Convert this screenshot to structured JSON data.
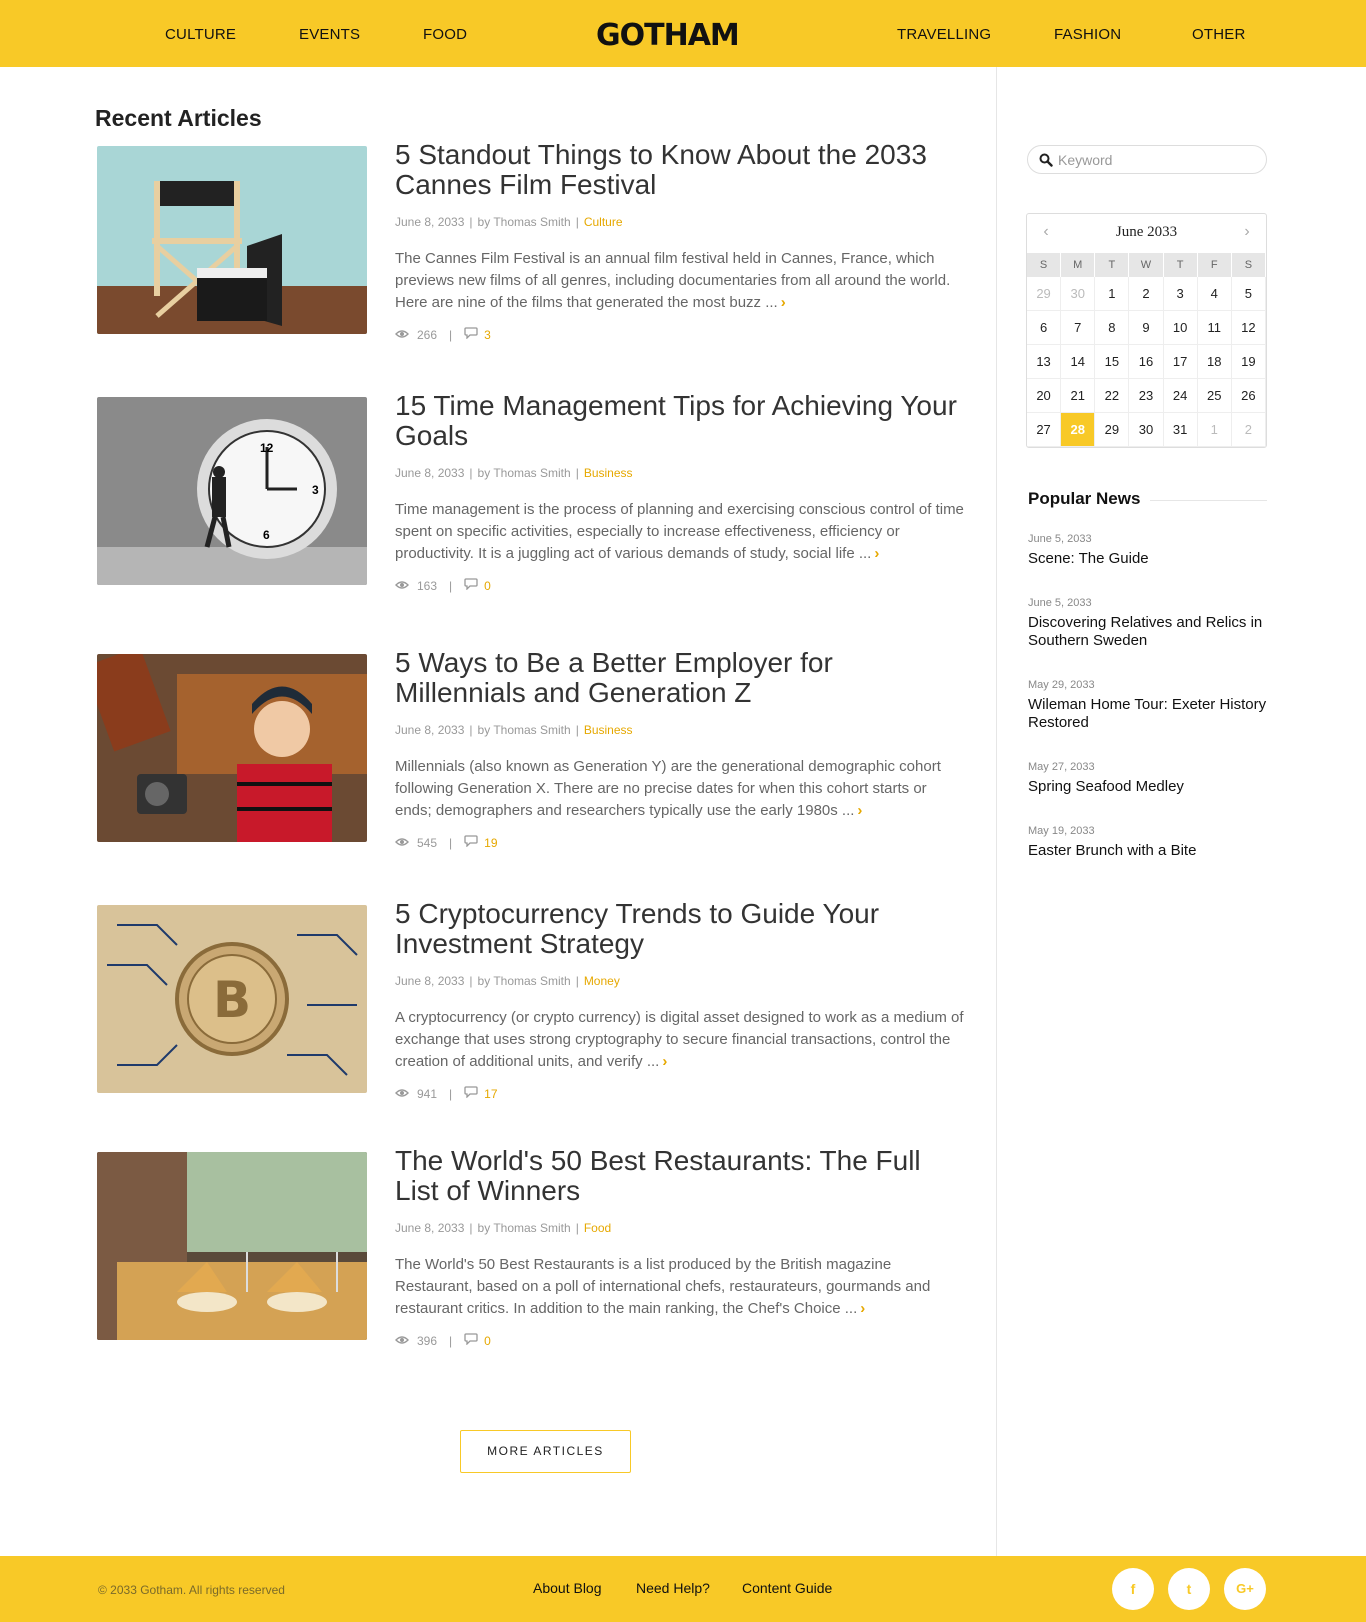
{
  "header": {
    "nav_left": [
      "CULTURE",
      "EVENTS",
      "FOOD"
    ],
    "logo": "GOTHAM",
    "nav_right": [
      "TRAVELLING",
      "FASHION",
      "OTHER"
    ]
  },
  "main": {
    "section_title": "Recent Articles",
    "articles": [
      {
        "title": "5 Standout Things to Know About the 2033 Cannes Film Festival",
        "date": "June 8, 2033",
        "author": "by Thomas Smith",
        "category": "Culture",
        "excerpt": "The Cannes Film Festival is an annual film festival held in Cannes, France, which previews new films of all genres, including documentaries from all around the world. Here are nine of the films that generated the most buzz ...",
        "views": "266",
        "comments": "3"
      },
      {
        "title": "15 Time Management Tips for Achieving Your Goals",
        "date": "June 8, 2033",
        "author": "by Thomas Smith",
        "category": "Business",
        "excerpt": "Time management is the process of planning and exercising conscious control of time spent on specific activities, especially to increase effectiveness, efficiency or productivity. It is a juggling act of various demands of study, social life ...",
        "views": "163",
        "comments": "0"
      },
      {
        "title": "5 Ways to Be a Better Employer for Millennials and Generation Z",
        "date": "June 8, 2033",
        "author": "by Thomas Smith",
        "category": "Business",
        "excerpt": "Millennials (also known as Generation Y) are the generational demographic cohort following Generation X. There are no precise dates for when this cohort starts or ends; demographers and researchers typically use the early 1980s ...",
        "views": "545",
        "comments": "19"
      },
      {
        "title": "5 Cryptocurrency Trends to Guide Your Investment Strategy",
        "date": "June 8, 2033",
        "author": "by Thomas Smith",
        "category": "Money",
        "excerpt": "A cryptocurrency (or crypto currency) is digital asset designed to work as a medium of exchange that uses strong cryptography to secure financial transactions, control the creation of additional units, and verify ...",
        "views": "941",
        "comments": "17"
      },
      {
        "title": "The World's 50 Best Restaurants: The Full List of Winners",
        "date": "June 8, 2033",
        "author": "by Thomas Smith",
        "category": "Food",
        "excerpt": "The World's 50 Best Restaurants is a list produced by the British magazine Restaurant, based on a poll of international chefs, restaurateurs, gourmands and restaurant critics. In addition to the main ranking, the Chef's Choice ...",
        "views": "396",
        "comments": "0"
      }
    ],
    "more_button": "MORE ARTICLES",
    "separator": "|"
  },
  "sidebar": {
    "search_placeholder": "Keyword",
    "calendar": {
      "month": "June 2033",
      "weekdays": [
        "S",
        "M",
        "T",
        "W",
        "T",
        "F",
        "S"
      ],
      "days": [
        {
          "d": "29",
          "muted": true
        },
        {
          "d": "30",
          "muted": true
        },
        {
          "d": "1"
        },
        {
          "d": "2"
        },
        {
          "d": "3"
        },
        {
          "d": "4"
        },
        {
          "d": "5"
        },
        {
          "d": "6"
        },
        {
          "d": "7"
        },
        {
          "d": "8"
        },
        {
          "d": "9"
        },
        {
          "d": "10"
        },
        {
          "d": "11"
        },
        {
          "d": "12"
        },
        {
          "d": "13"
        },
        {
          "d": "14"
        },
        {
          "d": "15"
        },
        {
          "d": "16"
        },
        {
          "d": "17"
        },
        {
          "d": "18"
        },
        {
          "d": "19"
        },
        {
          "d": "20"
        },
        {
          "d": "21"
        },
        {
          "d": "22"
        },
        {
          "d": "23"
        },
        {
          "d": "24"
        },
        {
          "d": "25"
        },
        {
          "d": "26"
        },
        {
          "d": "27"
        },
        {
          "d": "28",
          "today": true
        },
        {
          "d": "29"
        },
        {
          "d": "30"
        },
        {
          "d": "31"
        },
        {
          "d": "1",
          "muted": true
        },
        {
          "d": "2",
          "muted": true
        }
      ]
    },
    "popular_title": "Popular News",
    "popular": [
      {
        "date": "June 5, 2033",
        "title": "Scene: The Guide"
      },
      {
        "date": "June 5, 2033",
        "title": "Discovering Relatives and Relics in Southern Sweden"
      },
      {
        "date": "May 29, 2033",
        "title": "Wileman Home Tour: Exeter History Restored"
      },
      {
        "date": "May 27, 2033",
        "title": "Spring Seafood Medley"
      },
      {
        "date": "May 19, 2033",
        "title": "Easter Brunch with a Bite"
      }
    ]
  },
  "footer": {
    "copyright": "© 2033 Gotham. All rights reserved",
    "links": [
      "About Blog",
      "Need Help?",
      "Content Guide"
    ],
    "social": [
      {
        "icon": "facebook-icon",
        "glyph": "f"
      },
      {
        "icon": "twitter-icon",
        "glyph": "t"
      },
      {
        "icon": "google-plus-icon",
        "glyph": "G+"
      }
    ]
  },
  "colors": {
    "brand_yellow": "#f8c927",
    "accent": "#e6a800"
  }
}
